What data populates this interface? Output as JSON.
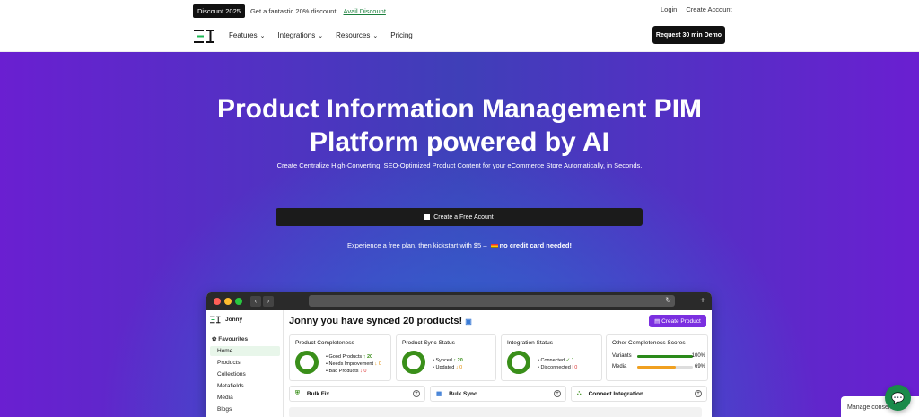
{
  "topbar": {
    "badge": "Discount 2025",
    "promo_text": "Get a fantastic 20% discount,",
    "promo_link": "Avail Discount",
    "login": "Login",
    "create_account": "Create Account"
  },
  "nav": {
    "items": [
      "Features",
      "Integrations",
      "Resources",
      "Pricing"
    ],
    "demo": "Request 30 min Demo"
  },
  "hero": {
    "title_line1": "Product Information Management PIM",
    "title_line2": "Platform powered by AI",
    "sub_pre": "Create Centralize High-Converting, ",
    "sub_link": "SEO-Optimized Product Content",
    "sub_post": " for your eCommerce Store Automatically, in Seconds.",
    "cta": "Create a Free Acount",
    "note_pre": "Experience a free plan, then kickstart with $5 – ",
    "note_bold": "no credit card needed!"
  },
  "app": {
    "user": "Jonny",
    "favourites": "Favourites",
    "sidebar": [
      "Home",
      "Products",
      "Collections",
      "Metafields",
      "Media",
      "Blogs"
    ],
    "title": "Jonny you have synced 20 products!",
    "create_button": "Create Product",
    "cards": {
      "completeness": {
        "title": "Product Completeness",
        "good": "Good Products",
        "good_n": "20",
        "needs": "Needs Improvement",
        "needs_n": "0",
        "bad": "Bad Products",
        "bad_n": "0"
      },
      "sync": {
        "title": "Product Sync Status",
        "synced": "Synced",
        "synced_n": "20",
        "updated": "Updated",
        "updated_n": "0"
      },
      "integration": {
        "title": "Integration Status",
        "connected": "Connected",
        "connected_n": "1",
        "disconnected": "Disconnected",
        "disconnected_n": "0"
      },
      "scores": {
        "title": "Other Completeness Scores",
        "variants": "Variants",
        "variants_pct": "100%",
        "variants_value": 1.0,
        "media": "Media",
        "media_pct": "69%",
        "media_value": 0.69
      }
    },
    "actions": [
      "Bulk Fix",
      "Bulk Sync",
      "Connect Integration"
    ]
  },
  "footer": {
    "consent": "Manage consent"
  },
  "colors": {
    "accent_purple": "#7b2fe0",
    "green": "#3a8f1a",
    "orange": "#f0a020"
  }
}
